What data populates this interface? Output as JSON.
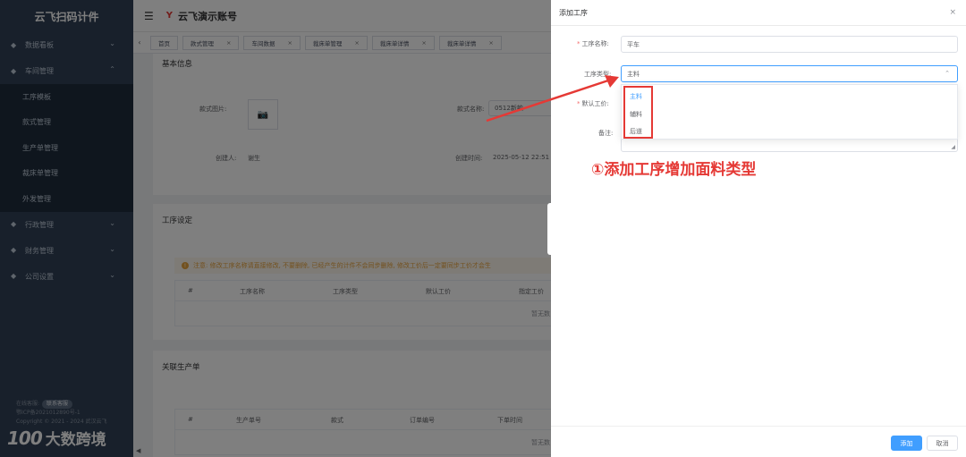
{
  "sidebar": {
    "logo": "云飞扫码计件",
    "menu": [
      {
        "label": "数据看板",
        "icon": "tag-icon",
        "chevron": "⌄"
      },
      {
        "label": "车间管理",
        "icon": "tag-icon",
        "chevron": "⌃"
      }
    ],
    "submenu": [
      "工序模板",
      "款式管理",
      "生产单管理",
      "裁床单管理",
      "外发管理"
    ],
    "menu_after": [
      {
        "label": "行政管理",
        "chevron": "⌄"
      },
      {
        "label": "财务管理",
        "chevron": "⌄"
      },
      {
        "label": "公司设置",
        "chevron": "⌄"
      }
    ],
    "footer": {
      "online_label": "在线客服:",
      "contact_button": "联系客服",
      "icp": "鄂ICP备2021012890号-1",
      "copyright": "Copyright © 2021 - 2024 武汉云飞"
    },
    "watermark": {
      "logo": "100",
      "text": "大数跨境"
    },
    "collapse_glyph": "◀"
  },
  "navbar": {
    "menu_glyph": "☰",
    "brand_glyph": "Y",
    "title": "云飞演示账号"
  },
  "tags": {
    "scroll_glyph": "‹",
    "items": [
      "首页",
      "款式管理",
      "车间数据",
      "裁床单管理",
      "裁床单详情",
      "裁床单详情"
    ],
    "close_glyph": "×"
  },
  "page": {
    "basic_info": {
      "title": "基本信息",
      "style_image_label": "款式图片:",
      "camera_glyph": "📷",
      "style_name_label": "款式名称:",
      "style_name_value": "0512新款",
      "creator_label": "创建人:",
      "creator_value": "谢生",
      "created_time_label": "创建时间:",
      "created_time_value": "2025-05-12 22:51"
    },
    "process": {
      "title": "工序设定",
      "notice_glyph": "!",
      "notice": "注意: 修改工序名称请直接修改, 不要删除, 已经产生的计件不会同步删除, 修改工价后一定要同步工价才会生",
      "headers": [
        "#",
        "工序名称",
        "工序类型",
        "默认工价",
        "指定工价"
      ],
      "empty": "暂无数"
    },
    "orders": {
      "title": "关联生产单",
      "headers": [
        "#",
        "生产单号",
        "款式",
        "订单编号",
        "下单时间"
      ],
      "empty": "暂无数"
    }
  },
  "drawer": {
    "title": "添加工序",
    "close_glyph": "×",
    "name_label": "工序名称:",
    "name_value": "平车",
    "type_label": "工序类型:",
    "type_value": "主料",
    "type_chevron": "⌃",
    "price_label": "默认工价:",
    "note_label": "备注:",
    "resize_glyph": "◢",
    "required_mark": "*",
    "options": [
      "主料",
      "辅料",
      "后道"
    ],
    "annotation": "①添加工序增加面料类型",
    "submit": "添加",
    "cancel": "取消"
  },
  "colors": {
    "sidebar_bg": "#304156",
    "primary": "#409eff",
    "annotation_red": "#e53935"
  }
}
